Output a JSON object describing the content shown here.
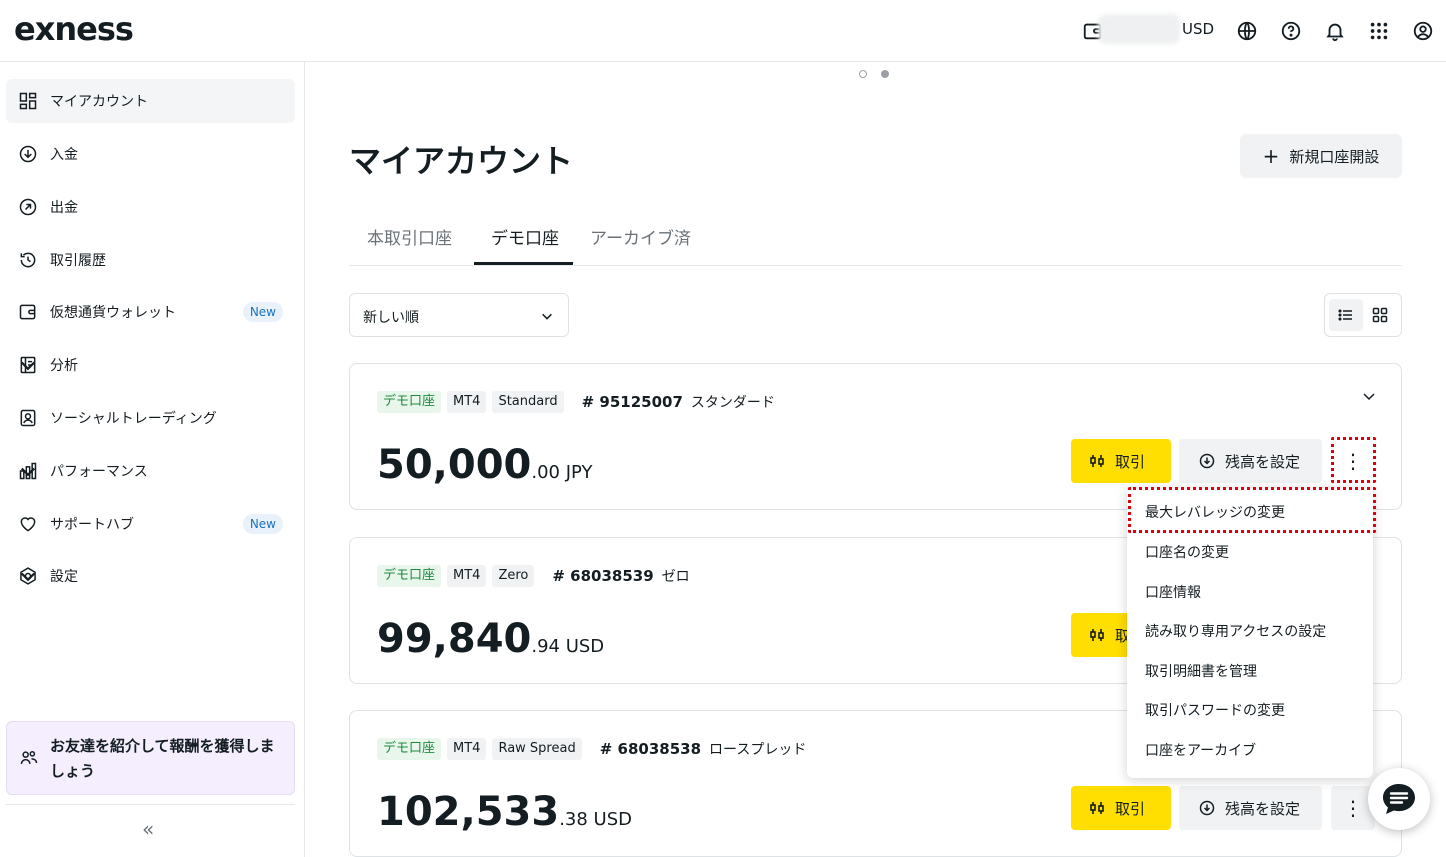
{
  "header": {
    "logo": "exness",
    "currency": "USD",
    "icons": [
      "wallet-icon",
      "globe-icon",
      "help-icon",
      "bell-icon",
      "apps-grid-icon",
      "profile-icon"
    ]
  },
  "sidebar": {
    "items": [
      {
        "label": "マイアカウント",
        "icon": "dashboard-icon",
        "active": true
      },
      {
        "label": "入金",
        "icon": "deposit-icon"
      },
      {
        "label": "出金",
        "icon": "withdraw-icon"
      },
      {
        "label": "取引履歴",
        "icon": "history-icon"
      },
      {
        "label": "仮想通貨ウォレット",
        "icon": "wallet-icon",
        "badge": "New"
      },
      {
        "label": "分析",
        "icon": "analytics-icon"
      },
      {
        "label": "ソーシャルトレーディング",
        "icon": "social-trading-icon"
      },
      {
        "label": "パフォーマンス",
        "icon": "performance-icon"
      },
      {
        "label": "サポートハブ",
        "icon": "heart-icon",
        "badge": "New"
      },
      {
        "label": "設定",
        "icon": "settings-icon"
      }
    ],
    "promo": "お友達を紹介して報酬を獲得しましょう",
    "collapse": "«"
  },
  "main": {
    "title": "マイアカウント",
    "new_account_button": "新規口座開設",
    "tabs": [
      "本取引口座",
      "デモ口座",
      "アーカイブ済"
    ],
    "active_tab": 1,
    "sort_label": "新しい順",
    "accounts": [
      {
        "tags": [
          "デモ口座",
          "MT4",
          "Standard"
        ],
        "number": "# 95125007",
        "name": "スタンダード",
        "balance_int": "50,000",
        "balance_dec": ".00 JPY"
      },
      {
        "tags": [
          "デモ口座",
          "MT4",
          "Zero"
        ],
        "number": "# 68038539",
        "name": "ゼロ",
        "balance_int": "99,840",
        "balance_dec": ".94 USD"
      },
      {
        "tags": [
          "デモ口座",
          "MT4",
          "Raw Spread"
        ],
        "number": "# 68038538",
        "name": "ロースプレッド",
        "balance_int": "102,533",
        "balance_dec": ".38 USD"
      }
    ],
    "trade_label": "取引",
    "trade_label_partial": "取",
    "set_balance_label": "残高を設定",
    "more_label": "⋮"
  },
  "context_menu": {
    "items": [
      "最大レバレッジの変更",
      "口座名の変更",
      "口座情報",
      "読み取り専用アクセスの設定",
      "取引明細書を管理",
      "取引パスワードの変更",
      "口座をアーカイブ"
    ]
  },
  "colors": {
    "accent_yellow": "#ffde02",
    "demo_green": "#1f8a3f",
    "highlight_red": "#e0000c",
    "badge_blue": "#1a73b8"
  }
}
